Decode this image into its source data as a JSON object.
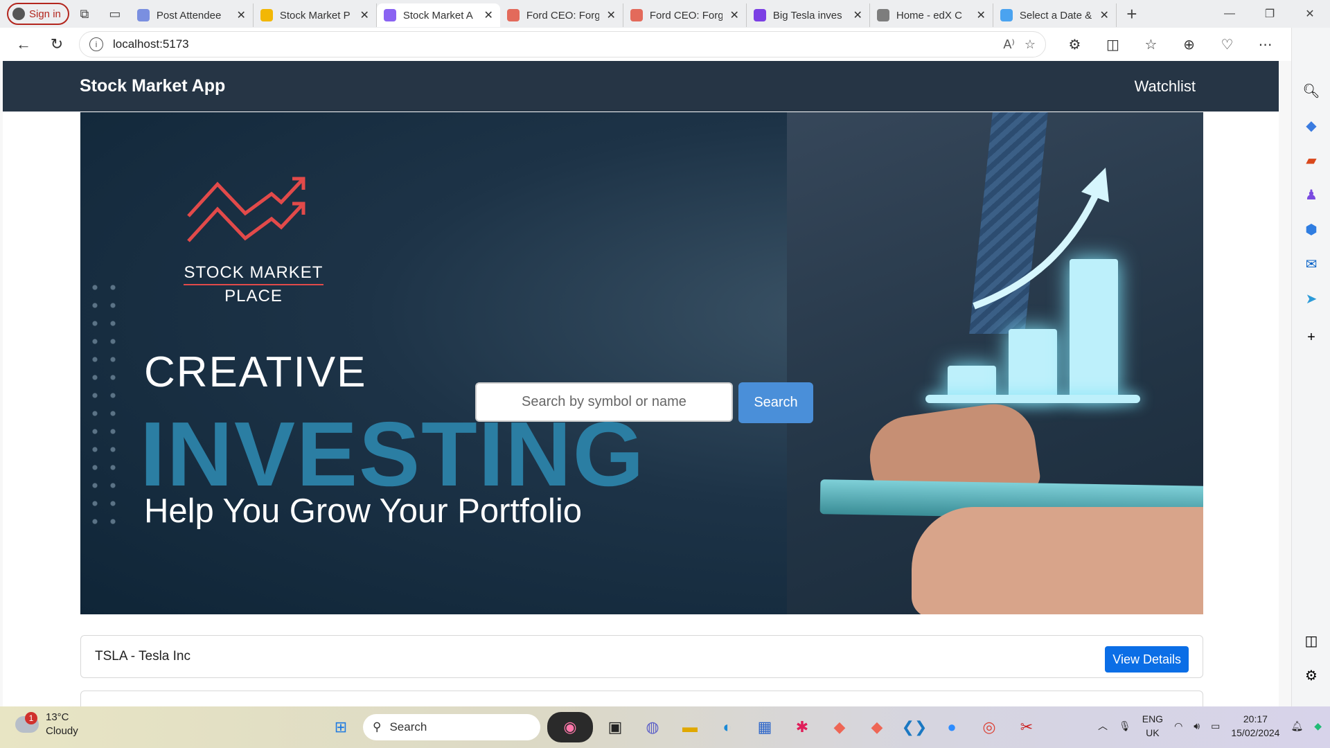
{
  "browser": {
    "sign_in": "Sign in",
    "tabs": [
      {
        "title": "Post Attendee",
        "color": "#7a8fe0",
        "active": false
      },
      {
        "title": "Stock Market P",
        "color": "#f2b705",
        "active": false
      },
      {
        "title": "Stock Market A",
        "color": "#8a63f2",
        "active": true
      },
      {
        "title": "Ford CEO: Forg",
        "color": "#e36a5b",
        "active": false
      },
      {
        "title": "Ford CEO: Forg",
        "color": "#e36a5b",
        "active": false
      },
      {
        "title": "Big Tesla inves",
        "color": "#7b3fe4",
        "active": false
      },
      {
        "title": "Home - edX C",
        "color": "#7d7d7d",
        "active": false
      },
      {
        "title": "Select a Date &",
        "color": "#4aa3f0",
        "active": false
      }
    ],
    "url": "localhost:5173"
  },
  "app": {
    "brand": "Stock Market App",
    "nav_watchlist": "Watchlist"
  },
  "hero": {
    "logo_line1": "STOCK MARKET",
    "logo_line2": "PLACE",
    "creative": "CREATIVE",
    "investing": "INVESTING",
    "tagline": "Help You Grow Your Portfolio"
  },
  "search": {
    "placeholder": "Search by symbol or name",
    "button": "Search"
  },
  "results": [
    {
      "label": "TSLA - Tesla Inc",
      "action": "View Details"
    }
  ],
  "taskbar": {
    "weather_temp": "13°C",
    "weather_desc": "Cloudy",
    "weather_badge": "1",
    "search": "Search",
    "lang_top": "ENG",
    "lang_bottom": "UK",
    "time": "20:17",
    "date": "15/02/2024"
  }
}
